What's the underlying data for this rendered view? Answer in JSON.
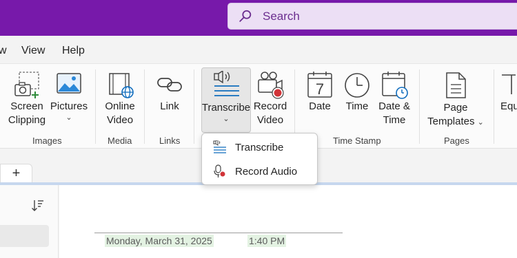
{
  "search": {
    "label": "Search"
  },
  "menu": [
    "w",
    "View",
    "Help"
  ],
  "ribbon": {
    "screen_clipping": [
      "Screen",
      "Clipping"
    ],
    "pictures": "Pictures",
    "online_video": [
      "Online",
      "Video"
    ],
    "link": "Link",
    "transcribe": "Transcribe",
    "record_video": [
      "Record",
      "Video"
    ],
    "date": "Date",
    "time": "Time",
    "date_time": [
      "Date &",
      "Time"
    ],
    "page_templates": [
      "Page",
      "Templates"
    ],
    "equation_partial": "Equ",
    "date_icon_number": "7",
    "groups": {
      "images": "Images",
      "media": "Media",
      "links": "Links",
      "time_stamp": "Time Stamp",
      "pages": "Pages"
    }
  },
  "dropdown": {
    "transcribe": "Transcribe",
    "record_audio": "Record Audio"
  },
  "section_tabs": {
    "add": "+"
  },
  "page": {
    "date": "Monday, March 31, 2025",
    "time": "1:40 PM"
  },
  "colors": {
    "title_bar": "#7719aa",
    "search_bg": "#ecdff5",
    "record_red": "#d13438",
    "link_blue": "#0f6cbd"
  }
}
